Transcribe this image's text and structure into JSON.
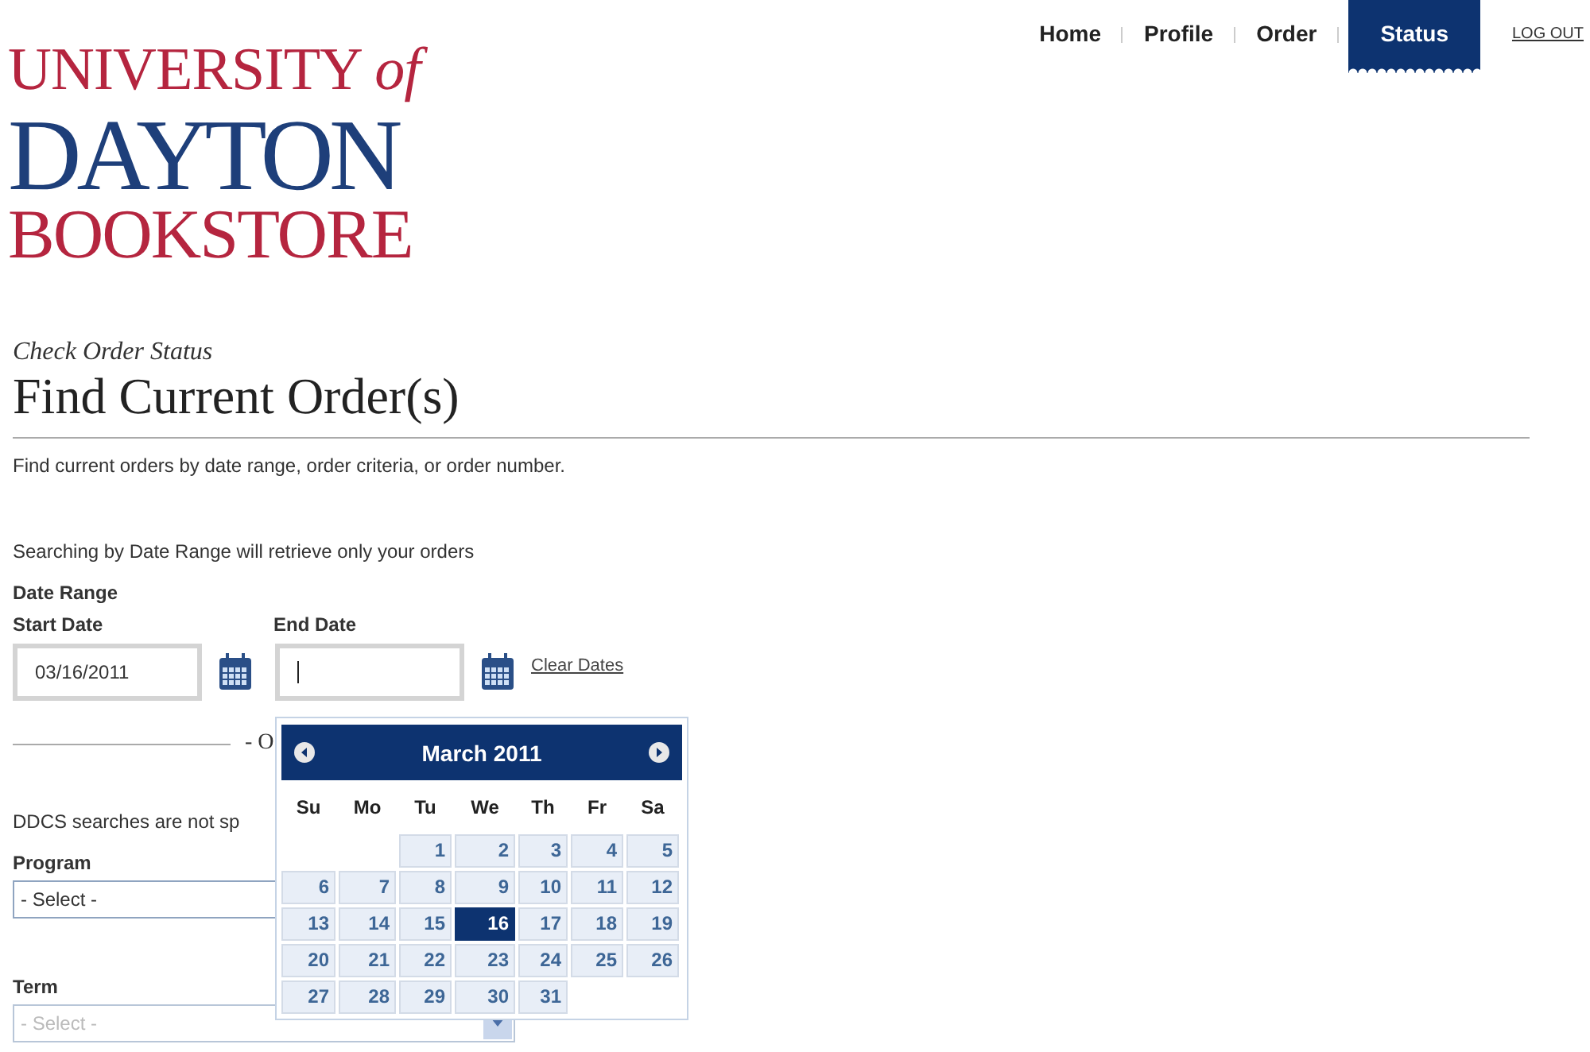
{
  "logo": {
    "line_1": "UNIVERSITY",
    "line_1_suffix": "of",
    "line_2": "DAYTON",
    "line_3": "BOOKSTORE"
  },
  "nav": [
    {
      "label": "Home",
      "kind": "tab",
      "selected": false
    },
    {
      "label": "Profile",
      "kind": "tab",
      "selected": false
    },
    {
      "label": "Order",
      "kind": "tab",
      "selected": false
    },
    {
      "label": "Status",
      "kind": "tab",
      "selected": true
    },
    {
      "label": "LOG OUT",
      "kind": "link",
      "selected": false
    }
  ],
  "page": {
    "kicker": "Check Order Status",
    "title": "Find Current Order(s)",
    "intro": "Find current orders by date range, order criteria, or order number."
  },
  "date_search": {
    "note": "Searching by Date Range will retrieve only your orders",
    "heading": "Date Range",
    "start_label": "Start Date",
    "start_value": "03/16/2011",
    "end_label": "End Date",
    "end_focused": true,
    "clear_link": "Clear Dates"
  },
  "divider_text": "- O",
  "ddcs_note": "DDCS searches are not sp",
  "program": {
    "label": "Program",
    "value": "- Select -",
    "disabled": false
  },
  "term": {
    "label": "Term",
    "value": "- Select -",
    "disabled": true
  },
  "calendar": {
    "month": "March 2011",
    "weekdays": [
      "Su",
      "Mo",
      "Tu",
      "We",
      "Th",
      "Fr",
      "Sa"
    ],
    "weeks": [
      [
        {
          "day": "1",
          "selected": false
        },
        {
          "day": "2",
          "selected": false
        },
        {
          "day": "3",
          "selected": false
        },
        {
          "day": "4",
          "selected": false
        },
        {
          "day": "5",
          "selected": false
        }
      ],
      [
        {
          "day": "6",
          "selected": false
        },
        {
          "day": "7",
          "selected": false
        },
        {
          "day": "8",
          "selected": false
        },
        {
          "day": "9",
          "selected": false
        },
        {
          "day": "10",
          "selected": false
        },
        {
          "day": "11",
          "selected": false
        },
        {
          "day": "12",
          "selected": false
        }
      ],
      [
        {
          "day": "13",
          "selected": false
        },
        {
          "day": "14",
          "selected": false
        },
        {
          "day": "15",
          "selected": false
        },
        {
          "day": "16",
          "selected": true
        },
        {
          "day": "17",
          "selected": false
        },
        {
          "day": "18",
          "selected": false
        },
        {
          "day": "19",
          "selected": false
        }
      ],
      [
        {
          "day": "20",
          "selected": false
        },
        {
          "day": "21",
          "selected": false
        },
        {
          "day": "22",
          "selected": false
        },
        {
          "day": "23",
          "selected": false
        },
        {
          "day": "24",
          "selected": false
        },
        {
          "day": "25",
          "selected": false
        },
        {
          "day": "26",
          "selected": false
        }
      ],
      [
        {
          "day": "27",
          "selected": false
        },
        {
          "day": "28",
          "selected": false
        },
        {
          "day": "29",
          "selected": false
        },
        {
          "day": "30",
          "selected": false
        },
        {
          "day": "31",
          "selected": false
        }
      ]
    ]
  }
}
